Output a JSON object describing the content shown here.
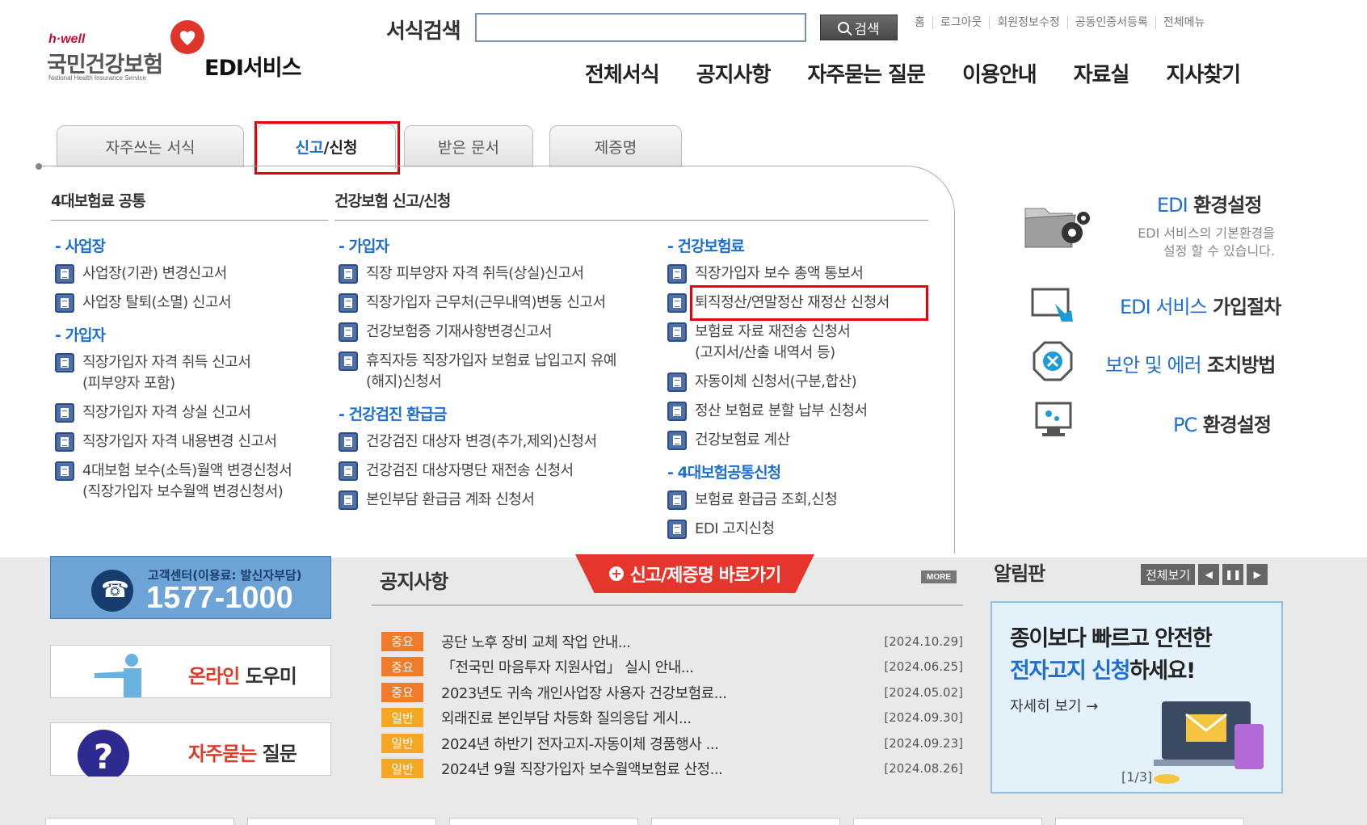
{
  "header": {
    "logo": {
      "tagline": "h·well",
      "brand": "국민건강보험",
      "brand_en": "National Health Insurance Service",
      "service": "EDI서비스",
      "brand_color": "#c8102e"
    },
    "search": {
      "label": "서식검색",
      "value": "",
      "placeholder": "",
      "button": "검색"
    },
    "top_links": [
      "홈",
      "로그아웃",
      "회원정보수정",
      "공동인증서등록",
      "전체메뉴"
    ],
    "gnb": [
      "전체서식",
      "공지사항",
      "자주묻는 질문",
      "이용안내",
      "자료실",
      "지사찾기"
    ]
  },
  "tabs": [
    {
      "label": "자주쓰는 서식",
      "active": false
    },
    {
      "label_hl": "신고",
      "label_rest": "/신청",
      "active": true
    },
    {
      "label": "받은 문서",
      "active": false
    },
    {
      "label": "제증명",
      "active": false
    }
  ],
  "menu": {
    "col1": {
      "title": "4대보험료 공통",
      "sections": [
        {
          "head": "- 사업장",
          "items": [
            "사업장(기관) 변경신고서",
            "사업장 탈퇴(소멸) 신고서"
          ]
        },
        {
          "head": "- 가입자",
          "items": [
            [
              "직장가입자 자격 취득 신고서",
              "(피부양자 포함)"
            ],
            [
              "직장가입자 자격 상실 신고서"
            ],
            [
              "직장가입자 자격 내용변경 신고서"
            ],
            [
              "4대보험 보수(소득)월액 변경신청서",
              "(직장가입자 보수월액 변경신청서)"
            ]
          ]
        }
      ]
    },
    "col2": {
      "title": "건강보험 신고/신청",
      "sections": [
        {
          "head": "- 가입자",
          "items": [
            [
              "직장 피부양자 자격 취득(상실)신고서"
            ],
            [
              "직장가입자 근무처(근무내역)변동 신고서"
            ],
            [
              "건강보험증 기재사항변경신고서"
            ],
            [
              "휴직자등 직장가입자 보험료 납입고지 유예",
              "(해지)신청서"
            ]
          ]
        },
        {
          "head": "- 건강검진 환급금",
          "items": [
            [
              "건강검진 대상자 변경(추가,제외)신청서"
            ],
            [
              "건강검진 대상자명단 재전송 신청서"
            ],
            [
              "본인부담 환급금 계좌 신청서"
            ]
          ]
        }
      ]
    },
    "col3": {
      "sections": [
        {
          "head": "- 건강보험료",
          "items": [
            [
              "직장가입자 보수 총액 통보서"
            ],
            [
              "퇴직정산/연말정산 재정산 신청서"
            ],
            [
              "보험료 자료 재전송 신청서",
              "(고지서/산출 내역서 등)"
            ],
            [
              "자동이체 신청서(구분,합산)"
            ],
            [
              "정산 보험료 분할 납부 신청서"
            ],
            [
              "건강보험료 계산"
            ]
          ]
        },
        {
          "head": "- 4대보험공통신청",
          "items": [
            [
              "보험료 환급금 조회,신청"
            ],
            [
              "EDI 고지신청"
            ]
          ]
        }
      ]
    }
  },
  "side": {
    "env": {
      "blue": "EDI",
      "title": "환경설정",
      "desc1": "EDI 서비스의 기본환경을",
      "desc2": "설정 할 수 있습니다."
    },
    "join": {
      "blue": "EDI 서비스",
      "title": "가입절차"
    },
    "error": {
      "blue": "보안 및 에러",
      "title": "조치방법"
    },
    "pc": {
      "blue": "PC",
      "title": "환경설정"
    }
  },
  "lower": {
    "cs": {
      "sub": "고객센터(이용료: 발신자부담)",
      "number": "1577-1000"
    },
    "helper": {
      "red": "온라인",
      "rest": " 도우미"
    },
    "faq": {
      "red": "자주묻는",
      "rest": " 질문"
    },
    "notice": {
      "title": "공지사항",
      "quick": "신고/제증명 바로가기",
      "more": "MORE",
      "rows": [
        {
          "badge": "중요",
          "type": "imp",
          "title": "공단 노후 장비 교체 작업 안내...",
          "date": "[2024.10.29]"
        },
        {
          "badge": "중요",
          "type": "imp",
          "title": "「전국민 마음투자 지원사업」 실시 안내...",
          "date": "[2024.06.25]"
        },
        {
          "badge": "중요",
          "type": "imp",
          "title": "2023년도 귀속 개인사업장 사용자 건강보험료...",
          "date": "[2024.05.02]"
        },
        {
          "badge": "일반",
          "type": "gen",
          "title": "외래진료 본인부담 차등화 질의응답 게시...",
          "date": "[2024.09.30]"
        },
        {
          "badge": "일반",
          "type": "gen",
          "title": "2024년 하반기 전자고지-자동이체 경품행사 ...",
          "date": "[2024.09.23]"
        },
        {
          "badge": "일반",
          "type": "gen",
          "title": "2024년 9월 직장가입자 보수월액보험료 산정...",
          "date": "[2024.08.26]"
        }
      ]
    },
    "alarm": {
      "title": "알림판",
      "all": "전체보기",
      "banner_l1": "종이보다 빠르고 안전한",
      "banner_l2_blue": "전자고지 신청",
      "banner_l2_rest": "하세요!",
      "banner_more": "자세히 보기 →",
      "pager": "[1/3]"
    }
  }
}
